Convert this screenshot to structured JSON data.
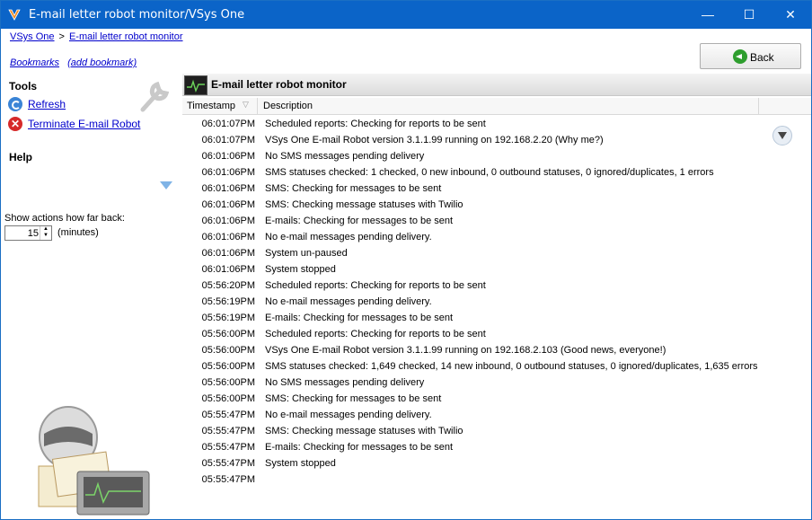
{
  "window": {
    "title": "E-mail letter robot monitor/VSys One",
    "minimize": "—",
    "maximize": "☐",
    "close": "✕"
  },
  "breadcrumb": {
    "root": "VSys One",
    "separator": ">",
    "current": "E-mail letter robot monitor"
  },
  "bookmarks": {
    "bookmarks_link": "Bookmarks",
    "add_link": "(add bookmark)"
  },
  "back_button": {
    "label": "Back"
  },
  "sidebar": {
    "tools_heading": "Tools",
    "refresh": "Refresh",
    "terminate": "Terminate E-mail Robot",
    "help_heading": "Help",
    "back_label": "Show actions how far back:",
    "back_value": "15",
    "units": "(minutes)"
  },
  "panel": {
    "title": "E-mail letter robot monitor"
  },
  "columns": {
    "timestamp": "Timestamp",
    "description": "Description"
  },
  "rows": [
    {
      "ts": "06:01:07PM",
      "desc": "Scheduled reports: Checking for reports to be sent"
    },
    {
      "ts": "06:01:07PM",
      "desc": "VSys One E-mail Robot version 3.1.1.99  running on 192.168.2.20 (Why me?)"
    },
    {
      "ts": "06:01:06PM",
      "desc": "No SMS messages pending delivery"
    },
    {
      "ts": "06:01:06PM",
      "desc": "SMS statuses checked: 1 checked, 0 new inbound, 0 outbound statuses, 0 ignored/duplicates, 1 errors"
    },
    {
      "ts": "06:01:06PM",
      "desc": "SMS: Checking for messages to be sent"
    },
    {
      "ts": "06:01:06PM",
      "desc": "SMS: Checking message statuses with Twilio"
    },
    {
      "ts": "06:01:06PM",
      "desc": "E-mails: Checking for messages to be sent"
    },
    {
      "ts": "06:01:06PM",
      "desc": "No e-mail messages pending delivery."
    },
    {
      "ts": "06:01:06PM",
      "desc": "System un-paused"
    },
    {
      "ts": "06:01:06PM",
      "desc": "System stopped"
    },
    {
      "ts": "05:56:20PM",
      "desc": "Scheduled reports: Checking for reports to be sent"
    },
    {
      "ts": "05:56:19PM",
      "desc": "No e-mail messages pending delivery."
    },
    {
      "ts": "05:56:19PM",
      "desc": "E-mails: Checking for messages to be sent"
    },
    {
      "ts": "05:56:00PM",
      "desc": "Scheduled reports: Checking for reports to be sent"
    },
    {
      "ts": "05:56:00PM",
      "desc": "VSys One E-mail Robot version 3.1.1.99  running on 192.168.2.103 (Good news, everyone!)"
    },
    {
      "ts": "05:56:00PM",
      "desc": "SMS statuses checked: 1,649 checked, 14 new inbound, 0 outbound statuses, 0 ignored/duplicates, 1,635 errors"
    },
    {
      "ts": "05:56:00PM",
      "desc": "No SMS messages pending delivery"
    },
    {
      "ts": "05:56:00PM",
      "desc": "SMS: Checking for messages to be sent"
    },
    {
      "ts": "05:55:47PM",
      "desc": "No e-mail messages pending delivery."
    },
    {
      "ts": "05:55:47PM",
      "desc": "SMS: Checking message statuses with Twilio"
    },
    {
      "ts": "05:55:47PM",
      "desc": "E-mails: Checking for messages to be sent"
    },
    {
      "ts": "05:55:47PM",
      "desc": "System stopped"
    },
    {
      "ts": "05:55:47PM",
      "desc": ""
    }
  ]
}
